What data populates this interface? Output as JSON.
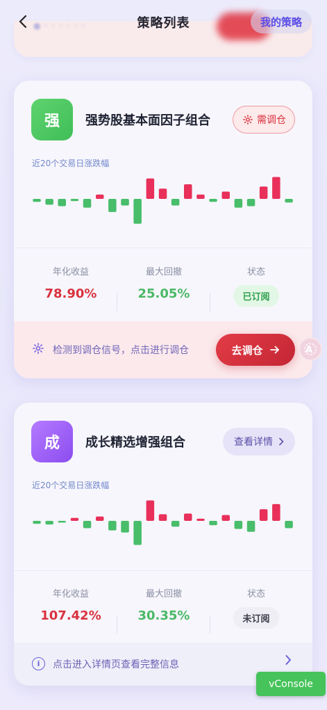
{
  "header": {
    "title": "策略列表",
    "my_strategy": "我的策略",
    "back_icon": "chevron-left-icon"
  },
  "cards": [
    {
      "badge": "强",
      "badge_color": "#4cc965",
      "title": "强势股基本面因子组合",
      "action_pill": "需调仓",
      "action_icon": "sun-signal-icon",
      "chart_label": "近20个交易日涨跌幅",
      "changes": [
        -0.4,
        -0.8,
        -1.0,
        -0.3,
        -1.2,
        0.6,
        -1.8,
        -0.9,
        -3.4,
        2.8,
        1.4,
        -0.9,
        2.0,
        0.6,
        -0.4,
        1.0,
        -1.2,
        -1.0,
        1.7,
        3.0,
        -0.5
      ],
      "stats": {
        "annual_label": "年化收益",
        "annual_value": "78.90%",
        "drawdown_label": "最大回撤",
        "drawdown_value": "25.05%",
        "status_label": "状态",
        "status_value": "已订阅"
      },
      "footer_text": "检测到调仓信号，点击进行调仓",
      "footer_button": "去调仓",
      "footer_button_icon": "arrow-right-icon"
    },
    {
      "badge": "成",
      "badge_color": "#a064f5",
      "title": "成长精选增强组合",
      "action_pill": "查看详情",
      "chart_label": "近20个交易日涨跌幅",
      "changes": [
        -0.4,
        -0.5,
        -0.2,
        0.4,
        -1.0,
        0.6,
        -1.3,
        -1.6,
        -3.3,
        2.8,
        0.9,
        -0.8,
        1.0,
        0.3,
        -0.6,
        0.8,
        -1.1,
        -1.5,
        1.6,
        2.3,
        -1.0
      ],
      "stats": {
        "annual_label": "年化收益",
        "annual_value": "107.42%",
        "drawdown_label": "最大回撤",
        "drawdown_value": "30.35%",
        "status_label": "状态",
        "status_value": "未订阅"
      },
      "footer_text": "点击进入详情页查看完整信息"
    }
  ],
  "colors": {
    "up": "#e8305a",
    "down": "#48bd6a",
    "accent": "#5b4ce6"
  },
  "vconsole": "vConsole"
}
